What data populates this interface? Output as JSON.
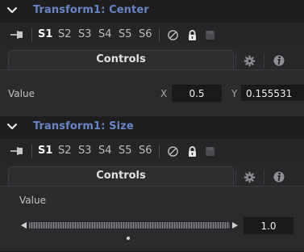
{
  "panels": [
    {
      "title": "Transform1: Center",
      "slots": [
        "S1",
        "S2",
        "S3",
        "S4",
        "S5",
        "S6"
      ],
      "active_slot": "S1",
      "tab_label": "Controls",
      "control": {
        "label": "Value",
        "x_axis_label": "X",
        "x_value": "0.5",
        "y_axis_label": "Y",
        "y_value": "0.155531"
      }
    },
    {
      "title": "Transform1: Size",
      "slots": [
        "S1",
        "S2",
        "S3",
        "S4",
        "S5",
        "S6"
      ],
      "active_slot": "S1",
      "tab_label": "Controls",
      "control": {
        "label": "Value",
        "value": "1.0"
      }
    }
  ],
  "icons": {
    "collapse": "chevron-down-icon",
    "pin": "pin-icon",
    "disable": "disable-icon",
    "lock": "lock-icon",
    "save": "save-icon",
    "settings": "gear-icon",
    "info": "info-icon",
    "slider_left": "triangle-left-icon",
    "slider_right": "triangle-right-icon"
  },
  "colors": {
    "panel_bg": "#28282a",
    "header_bg": "#1e1e20",
    "title": "#6b84c4",
    "field_bg": "#1a1a1c",
    "active_slot": "#ffffff"
  }
}
